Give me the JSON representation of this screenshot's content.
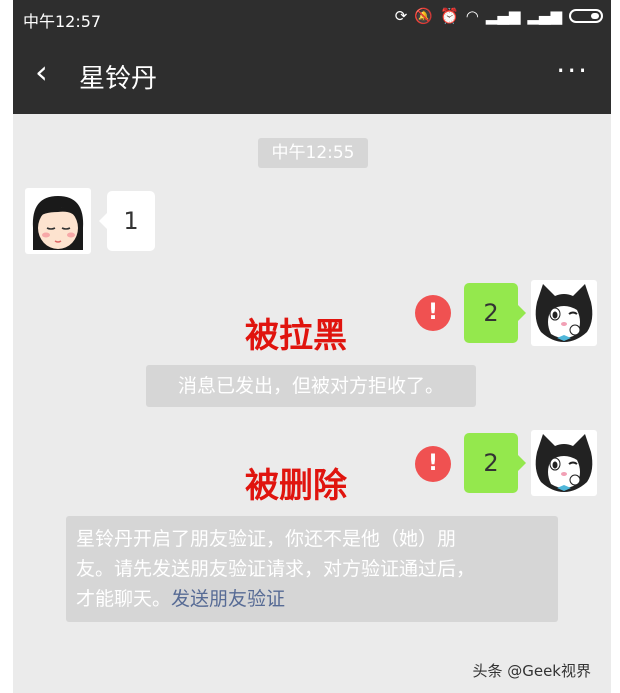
{
  "status_bar": {
    "time": "中午12:57",
    "icons": [
      "sync-icon",
      "mute-icon",
      "alarm-icon",
      "wifi-icon",
      "signal-icon",
      "signal-icon",
      "battery-icon"
    ]
  },
  "header": {
    "back_glyph": "‹",
    "title": "星铃丹",
    "more_glyph": "···"
  },
  "chat": {
    "timestamp": "中午12:55",
    "messages": [
      {
        "side": "left",
        "text": "1"
      },
      {
        "side": "right",
        "text": "2",
        "failed": true
      },
      {
        "side": "right",
        "text": "2",
        "failed": true
      }
    ],
    "annotations": [
      "被拉黑",
      "被删除"
    ],
    "system_blocked": "消息已发出，但被对方拒收了。",
    "system_deleted_line1": "星铃丹开启了朋友验证，你还不是他（她）朋",
    "system_deleted_line2": "友。请先发送朋友验证请求，对方验证通过后，",
    "system_deleted_line3": "才能聊天。",
    "system_deleted_link": "发送朋友验证",
    "error_glyph": "!"
  },
  "watermark": "头条 @Geek视界",
  "colors": {
    "header_bg": "#2e2e2e",
    "chat_bg": "#ebebeb",
    "sent_bubble": "#94e84d",
    "error": "#f05151",
    "annotation": "#e0140e",
    "link": "#576b95"
  }
}
